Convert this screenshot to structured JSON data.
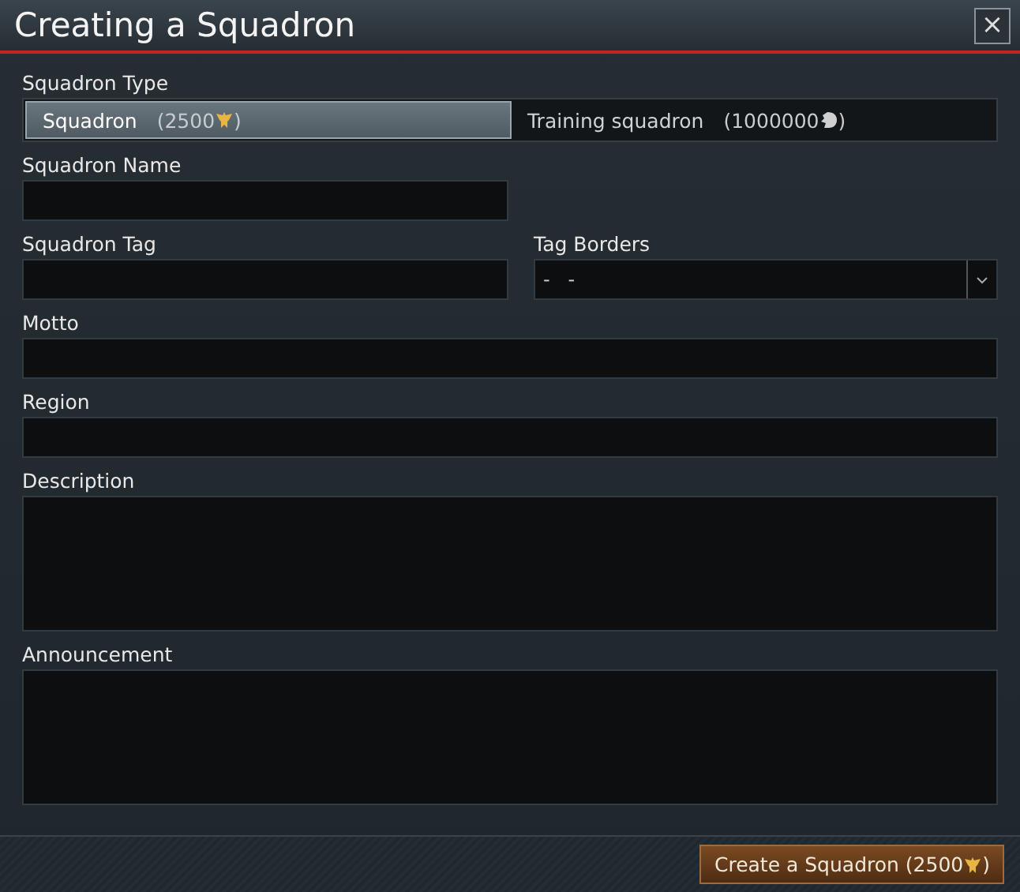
{
  "window": {
    "title": "Creating a Squadron",
    "close": "×"
  },
  "squadron_type": {
    "label": "Squadron Type",
    "options": [
      {
        "label": "Squadron",
        "price": {
          "kind": "eagle",
          "text": "(2500",
          "end": ")"
        },
        "selected": true
      },
      {
        "label": "Training squadron",
        "price": {
          "kind": "lion",
          "text": "(1000000",
          "end": ")"
        },
        "selected": false
      }
    ]
  },
  "rows": [
    [
      {
        "kind": "short_text",
        "label": "Squadron Name"
      }
    ],
    [
      {
        "kind": "short_text",
        "label": "Squadron Tag"
      },
      {
        "kind": "select",
        "label": "Tag Borders",
        "value": "-   -"
      }
    ],
    [
      {
        "kind": "text",
        "label": "Motto"
      }
    ],
    [
      {
        "kind": "text",
        "label": "Region"
      }
    ],
    [
      {
        "kind": "area",
        "label": "Description"
      }
    ],
    [
      {
        "kind": "area",
        "label": "Announcement"
      }
    ]
  ],
  "footer": {
    "button": {
      "text": "Create a Squadron (2500",
      "end": ")",
      "icon": {
        "kind": "eagle"
      }
    }
  }
}
